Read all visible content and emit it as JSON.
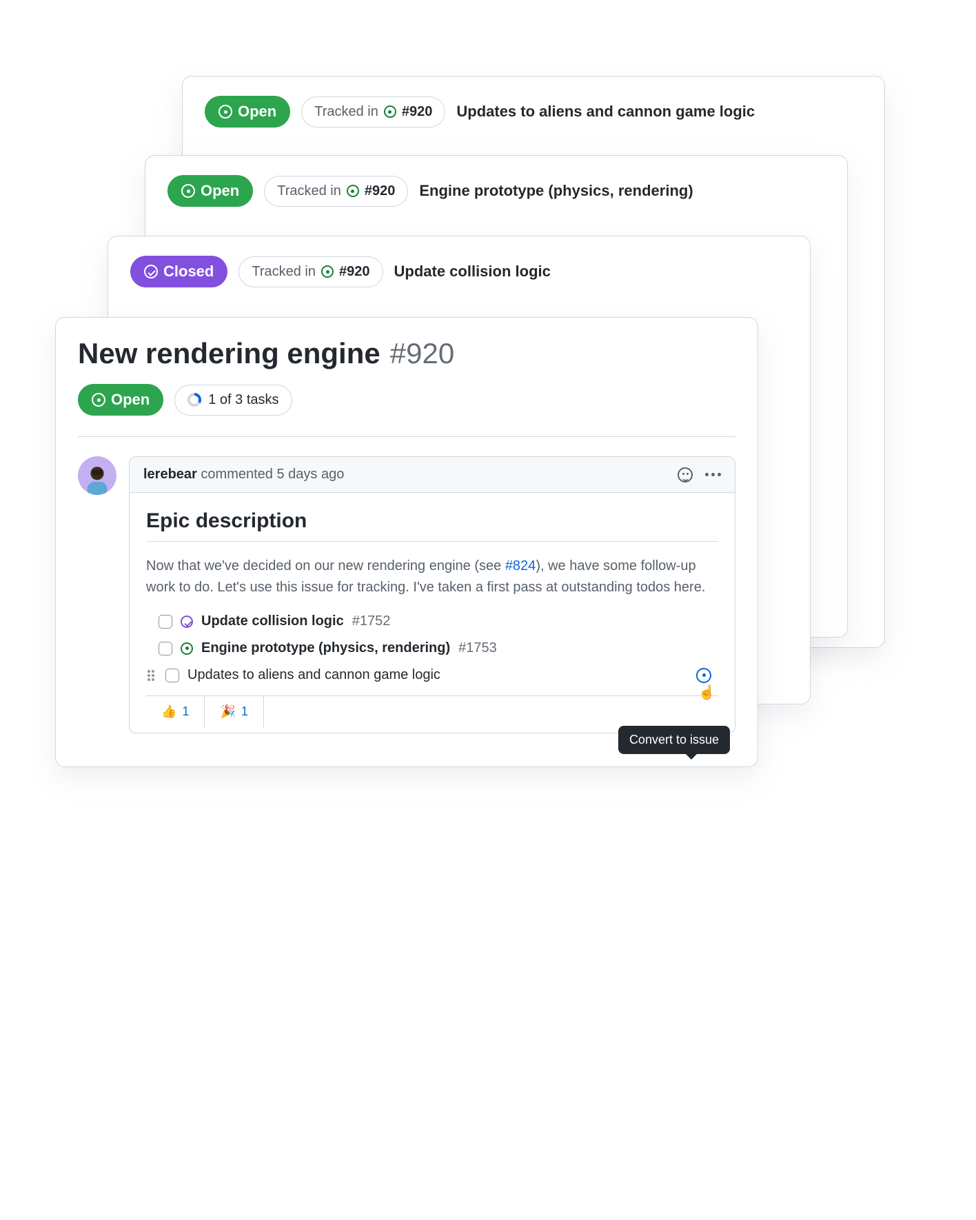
{
  "colors": {
    "open": "#2da44e",
    "closed": "#8250df",
    "link": "#0969da",
    "issueGreen": "#1a7f37"
  },
  "cards": [
    {
      "status": "Open",
      "statusKind": "open",
      "trackedLabel": "Tracked in",
      "trackedNum": "#920",
      "title": "Updates to aliens and cannon game logic"
    },
    {
      "status": "Open",
      "statusKind": "open",
      "trackedLabel": "Tracked in",
      "trackedNum": "#920",
      "title": "Engine prototype (physics, rendering)"
    },
    {
      "status": "Closed",
      "statusKind": "closed",
      "trackedLabel": "Tracked in",
      "trackedNum": "#920",
      "title": "Update collision logic"
    }
  ],
  "main": {
    "title": "New rendering engine",
    "issueNum": "#920",
    "status": "Open",
    "tasksLabel": "1 of 3 tasks",
    "tasksDone": 1,
    "tasksTotal": 3
  },
  "comment": {
    "author": "lerebear",
    "verb": "commented",
    "time": "5 days ago",
    "heading": "Epic description",
    "bodyPrefix": "Now that we've decided on our new rendering engine (see ",
    "bodyLink": "#824",
    "bodySuffix": "), we have some follow-up work to do. Let's use this issue for tracking. I've taken a first pass at outstanding todos here.",
    "tasks": [
      {
        "status": "closed",
        "title": "Update collision logic",
        "num": "#1752"
      },
      {
        "status": "open",
        "title": "Engine prototype (physics, rendering)",
        "num": "#1753"
      },
      {
        "status": "plain",
        "title": "Updates to aliens and cannon game logic",
        "num": ""
      }
    ],
    "reactions": [
      {
        "emoji": "👍",
        "count": "1"
      },
      {
        "emoji": "🎉",
        "count": "1"
      }
    ]
  },
  "tooltip": "Convert to issue"
}
